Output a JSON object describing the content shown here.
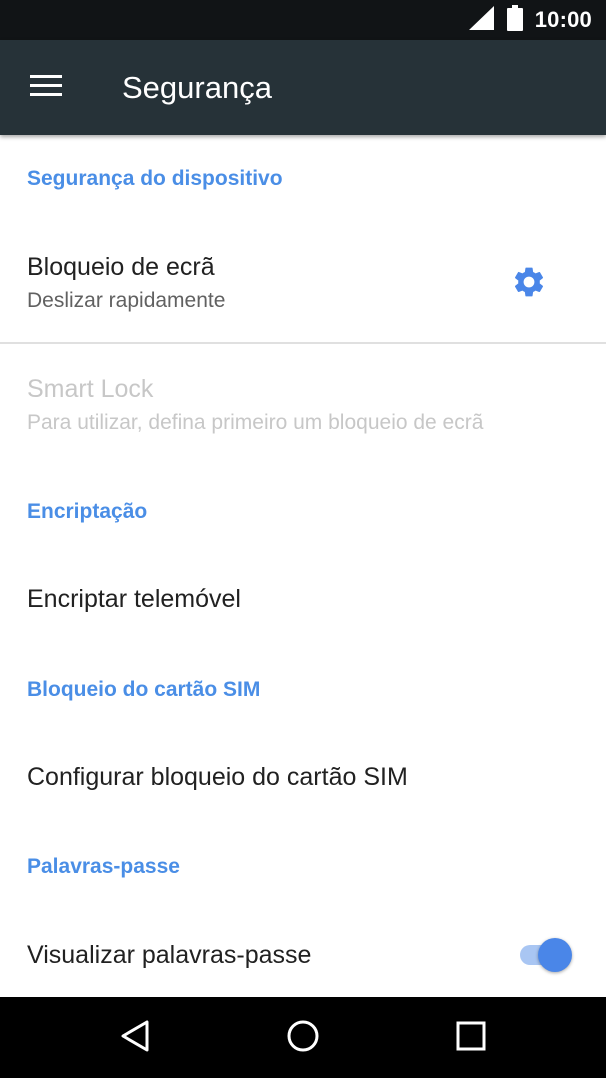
{
  "status_bar": {
    "time": "10:00",
    "icons": [
      "signal-icon",
      "battery-icon"
    ]
  },
  "app_bar": {
    "title": "Segurança",
    "menu_icon": "menu-icon"
  },
  "sections": {
    "device_security": {
      "header": "Segurança do dispositivo",
      "screen_lock": {
        "title": "Bloqueio de ecrã",
        "subtitle": "Deslizar rapidamente",
        "icon": "gear-icon"
      },
      "smart_lock": {
        "title": "Smart Lock",
        "subtitle": "Para utilizar, defina primeiro um bloqueio de ecrã"
      }
    },
    "encryption": {
      "header": "Encriptação",
      "encrypt_phone": {
        "title": "Encriptar telemóvel"
      }
    },
    "sim_lock": {
      "header": "Bloqueio do cartão SIM",
      "configure": {
        "title": "Configurar bloqueio do cartão SIM"
      }
    },
    "passwords": {
      "header": "Palavras-passe",
      "show_passwords": {
        "title": "Visualizar palavras-passe",
        "enabled": true
      }
    }
  },
  "colors": {
    "accent": "#4a8ee6",
    "app_bar": "#263238",
    "status_bar": "#111416",
    "toggle_thumb": "#4a86e8",
    "toggle_track": "#a9c6f3"
  },
  "nav_bar": {
    "icons": [
      "back-icon",
      "home-icon",
      "recents-icon"
    ]
  }
}
